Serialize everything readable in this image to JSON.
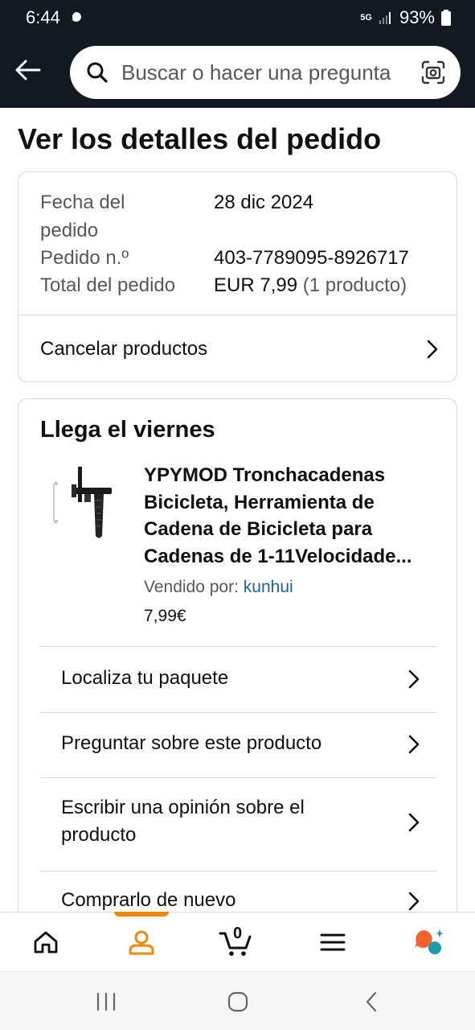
{
  "status_bar": {
    "time": "6:44",
    "network": "5G",
    "battery": "93%"
  },
  "search": {
    "placeholder": "Buscar o hacer una pregunta"
  },
  "page_title": "Ver los detalles del pedido",
  "order_summary": {
    "date_label_line1": "Fecha del",
    "date_label_line2": "pedido",
    "date_value": "28 dic 2024",
    "number_label": "Pedido n.º",
    "number_value": "403-7789095-8926717",
    "total_label": "Total del pedido",
    "total_value": "EUR 7,99",
    "total_count": "(1 producto)",
    "cancel_label": "Cancelar productos"
  },
  "delivery": {
    "title": "Llega el viernes",
    "product": {
      "title": "YPYMOD Tronchacadenas Bicicleta, Herramienta de Cadena de Bicicleta para Cadenas de 1-11Velocidade...",
      "sold_by_label": "Vendido por:",
      "seller": "kunhui",
      "price": "7,99€"
    },
    "actions": [
      {
        "label": "Localiza tu paquete"
      },
      {
        "label": "Preguntar sobre este producto"
      },
      {
        "label": "Escribir una opinión sobre el producto"
      },
      {
        "label": "Comprarlo de nuevo"
      }
    ]
  },
  "bottom_nav": {
    "cart_count": "0",
    "accent_color": "#f08804"
  }
}
